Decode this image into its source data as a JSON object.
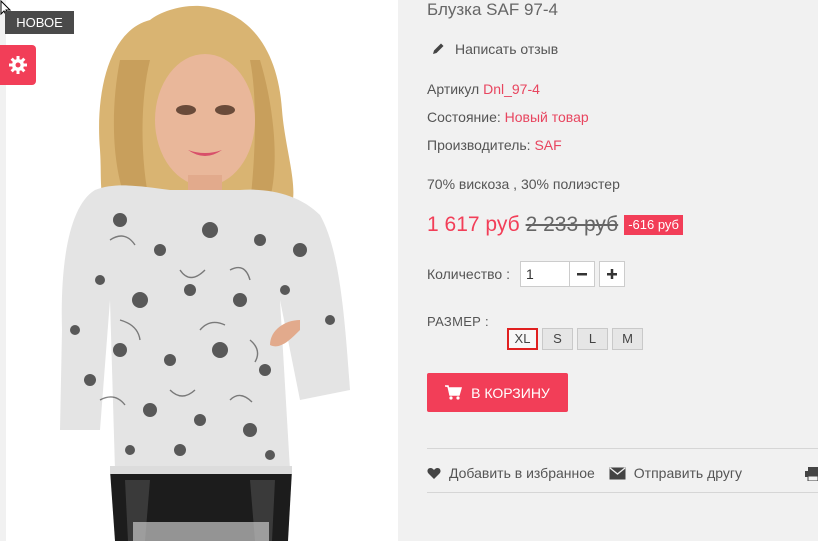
{
  "product": {
    "badge": "НОВОЕ",
    "title": "Блузка SAF 97-4",
    "review_label": "Написать отзыв",
    "sku_label": "Артикул",
    "sku_value": "Dnl_97-4",
    "condition_label": "Состояние:",
    "condition_value": "Новый товар",
    "manufacturer_label": "Производитель:",
    "manufacturer_value": "SAF",
    "composition": "70% вискоза , 30% полиэстер",
    "price": "1 617 руб",
    "old_price": "2 233 руб",
    "discount": "-616 руб"
  },
  "quantity": {
    "label": "Количество :",
    "value": "1"
  },
  "size": {
    "label": "РАЗМЕР :",
    "options": [
      "XL",
      "S",
      "L",
      "M"
    ],
    "selected": "XL"
  },
  "cart": {
    "button_label": "В КОРЗИНУ"
  },
  "actions": {
    "wishlist": "Добавить в избранное",
    "send_friend": "Отправить другу"
  },
  "icons": [
    "gear-icon",
    "pencil-icon",
    "minus-icon",
    "plus-icon",
    "cart-icon",
    "heart-icon",
    "envelope-icon",
    "print-icon"
  ],
  "colors": {
    "accent": "#f23e58",
    "badge_bg": "#4a4a4a",
    "selected_border": "#e02020"
  }
}
